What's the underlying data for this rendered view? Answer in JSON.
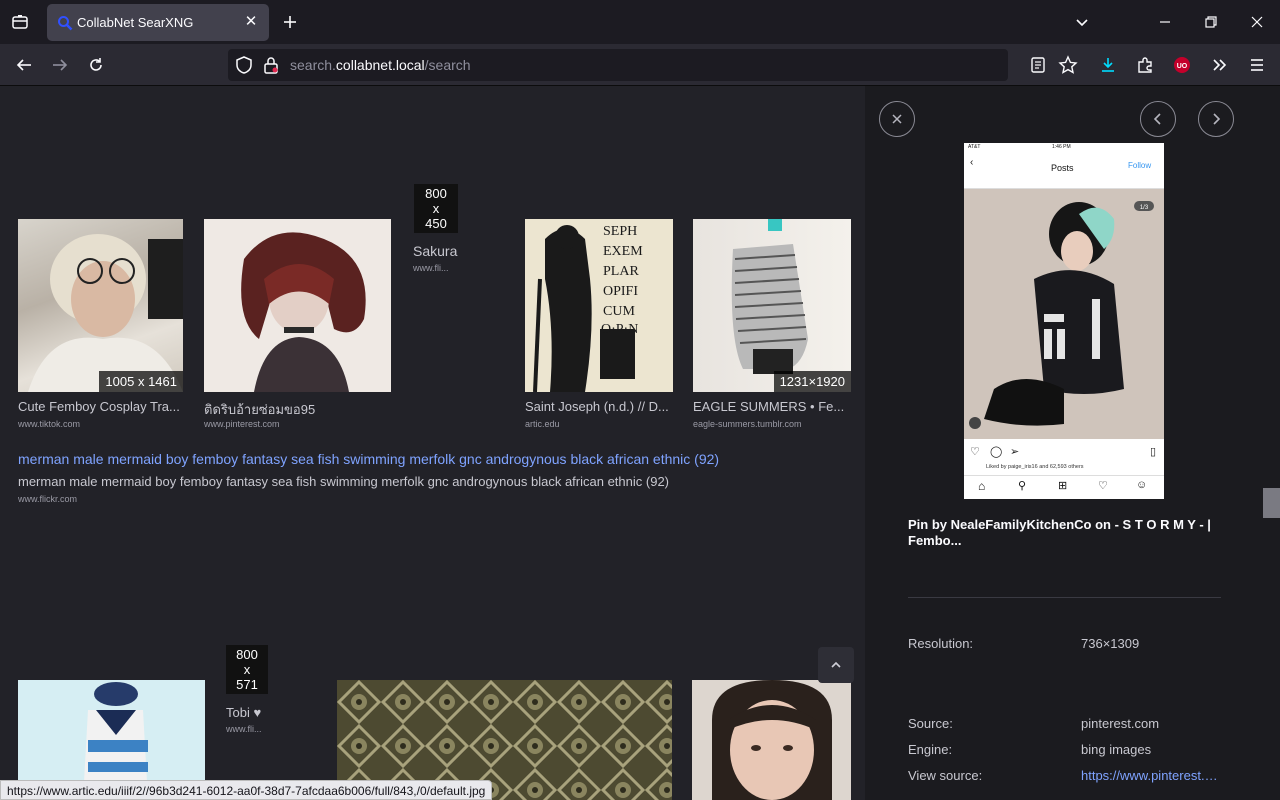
{
  "browser": {
    "tab_title": "CollabNet SearXNG",
    "url_prefix": "search.",
    "url_host": "collabnet.local",
    "url_path": "/search"
  },
  "results_row1": [
    {
      "title": "Cute Femboy Cosplay Tra...",
      "source": "www.tiktok.com",
      "resolution": "1005 x 1461"
    },
    {
      "title": "ติดริบอ้ายซ่อมขอ95",
      "source": "www.pinterest.com",
      "resolution": ""
    },
    {
      "title": "Sakura",
      "source": "www.fli...",
      "resolution": "800\nx\n450"
    },
    {
      "title": "Saint Joseph (n.d.) // D...",
      "source": "artic.edu",
      "resolution": ""
    },
    {
      "title": "EAGLE SUMMERS • Fe...",
      "source": "eagle-summers.tumblr.com",
      "resolution": "1231×1920"
    }
  ],
  "link_result": {
    "title": "merman male mermaid boy femboy fantasy sea fish swimming merfolk gnc androgynous black african ethnic (92)",
    "subtitle": "merman male mermaid boy femboy fantasy sea fish swimming merfolk gnc androgynous black african ethnic (92)",
    "source": "www.flickr.com"
  },
  "results_row2": [
    {
      "title": "Tobi ♥",
      "source": "www.fli...",
      "resolution": "800\nx\n571"
    }
  ],
  "detail": {
    "title": "Pin by NealeFamilyKitchenCo on - S T O R M Y - | Fembo...",
    "resolution_label": "Resolution:",
    "resolution_value": "736×1309",
    "source_label": "Source:",
    "source_value": "pinterest.com",
    "engine_label": "Engine:",
    "engine_value": "bing images",
    "view_source_label": "View source:",
    "view_source_value": "https://www.pinterest.com/pin/",
    "preview_header": "Posts",
    "preview_follow": "Follow",
    "preview_time": "1:46 PM",
    "preview_carrier": "AT&T",
    "preview_counter": "1/3",
    "preview_likes": "Liked by paige_iris16 and 62,593 others"
  },
  "statusbar": {
    "url": "https://www.artic.edu/iiif/2//96b3d241-6012-aa0f-38d7-7afcdaa6b006/full/843,/0/default.jpg"
  }
}
